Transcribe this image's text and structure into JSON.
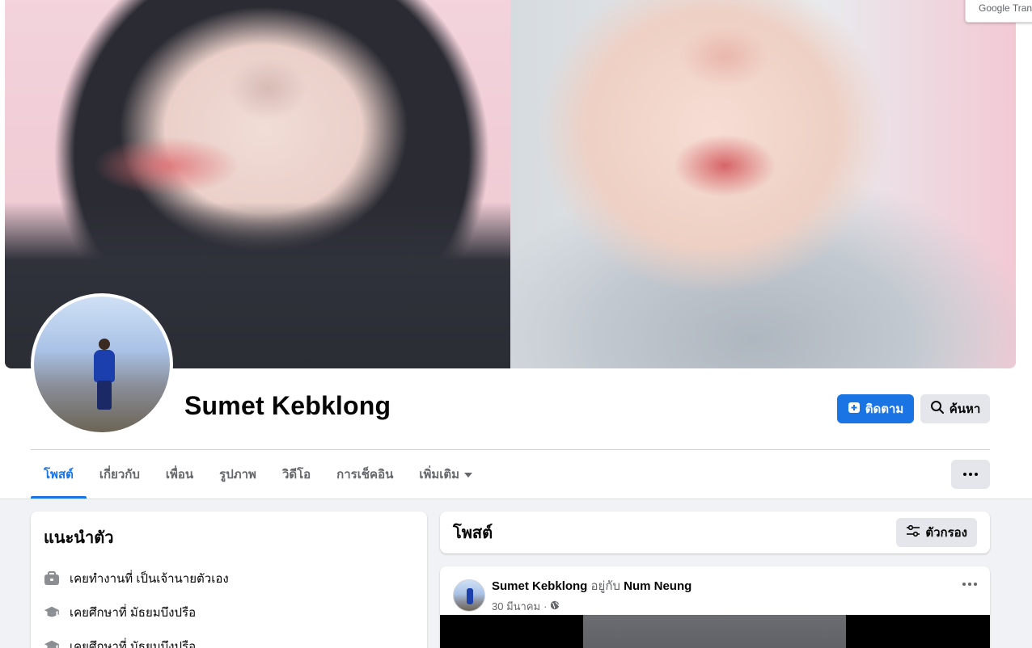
{
  "profile": {
    "name": "Sumet Kebklong"
  },
  "actions": {
    "follow_label": "ติดตาม",
    "search_label": "ค้นหา"
  },
  "tabs": [
    {
      "label": "โพสต์",
      "active": true
    },
    {
      "label": "เกี่ยวกับ",
      "active": false
    },
    {
      "label": "เพื่อน",
      "active": false
    },
    {
      "label": "รูปภาพ",
      "active": false
    },
    {
      "label": "วิดีโอ",
      "active": false
    },
    {
      "label": "การเช็คอิน",
      "active": false
    },
    {
      "label": "เพิ่มเติม",
      "active": false
    }
  ],
  "intro": {
    "title": "แนะนำตัว",
    "items": [
      {
        "icon": "briefcase-icon",
        "text": "เคยทำงานที่ เป็นเจ้านายตัวเอง"
      },
      {
        "icon": "graduation-cap-icon",
        "text": "เคยศึกษาที่ มัธยมบึงปรือ"
      },
      {
        "icon": "graduation-cap-icon",
        "text": "เคยศึกษาที่ มัธยมบึงปรือ"
      }
    ]
  },
  "posts": {
    "title": "โพสต์",
    "filter_label": "ตัวกรอง",
    "items": [
      {
        "author": "Sumet Kebklong",
        "with_text": "อยู่กับ",
        "tagged": "Num Neung",
        "date": "30 มีนาคม",
        "privacy_icon": "globe-icon"
      }
    ]
  },
  "translate_popup": {
    "text": "Google Trans"
  },
  "colors": {
    "accent": "#1b74e4",
    "secondary_button": "#e4e6eb",
    "page_background": "#f0f2f5",
    "muted_text": "#65676b"
  }
}
